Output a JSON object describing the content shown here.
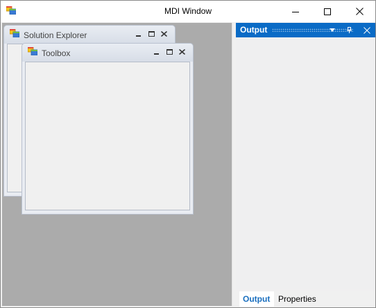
{
  "window": {
    "title": "MDI Window",
    "icon": "app-window-icon",
    "controls": [
      "minimize-icon",
      "maximize-icon",
      "close-icon"
    ]
  },
  "mdi_children": [
    {
      "title": "Solution Explorer",
      "icon": "app-window-icon"
    },
    {
      "title": "Toolbox",
      "icon": "app-window-icon"
    }
  ],
  "output_panel": {
    "title": "Output",
    "header_color": "#0a6bc6",
    "tabs": [
      {
        "label": "Output",
        "active": true
      },
      {
        "label": "Properties",
        "active": false
      }
    ]
  },
  "colors": {
    "mdi_background": "#ababab",
    "accent": "#0a6bc6",
    "active_tab_text": "#1a6fbf"
  }
}
